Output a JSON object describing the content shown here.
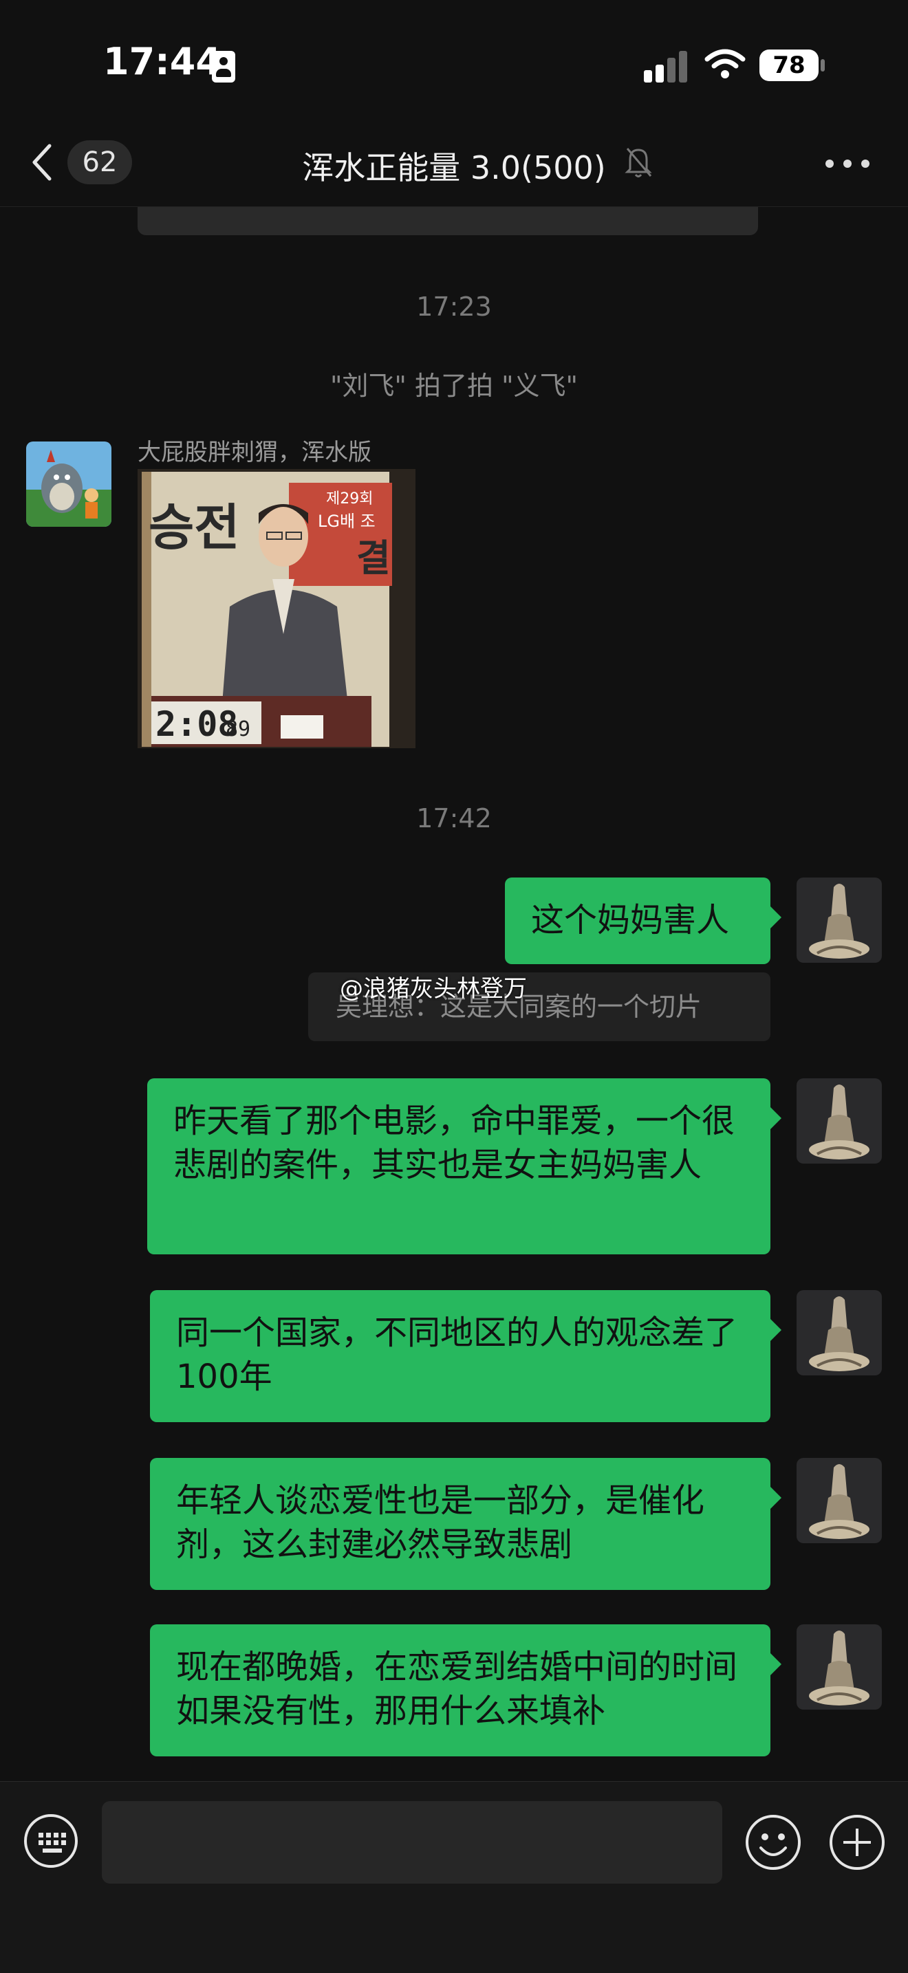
{
  "status_bar": {
    "time": "17:44",
    "battery": "78",
    "icons": [
      "id-card-icon",
      "cellular-signal-icon",
      "wifi-icon",
      "battery-icon"
    ]
  },
  "nav": {
    "unread_count": "62",
    "title": "浑水正能量 3.0(500)",
    "icons": [
      "back-chevron-icon",
      "mute-bell-icon",
      "more-dots-icon"
    ]
  },
  "chat": {
    "timestamps": [
      "17:23",
      "17:42"
    ],
    "system_message": "\"刘飞\" 拍了拍 \"义飞\"",
    "incoming": {
      "sender": "大屁股胖刺猬，浑水版",
      "photo_texts": [
        "승전",
        "제29회",
        "LG배 조",
        "결",
        "2:08",
        "89"
      ]
    },
    "outgoing": [
      "这个妈妈害人",
      "昨天看了那个电影，命中罪爱，一个很悲剧的案件，其实也是女主妈妈害人",
      "同一个国家，不同地区的人的观念差了100年",
      "年轻人谈恋爱性也是一部分，是催化剂，这么封建必然导致悲剧",
      "现在都晚婚，在恋爱到结婚中间的时间如果没有性，那用什么来填补"
    ],
    "quote": "吴理想：这是大同案的一个切片",
    "watermark": "@浪猪灰头林登万"
  },
  "input_bar": {
    "icons": [
      "keyboard-icon",
      "emoji-icon",
      "plus-icon"
    ]
  },
  "colors": {
    "background": "#111111",
    "bubble_green": "#27b85e",
    "quote_bg": "#222222"
  }
}
